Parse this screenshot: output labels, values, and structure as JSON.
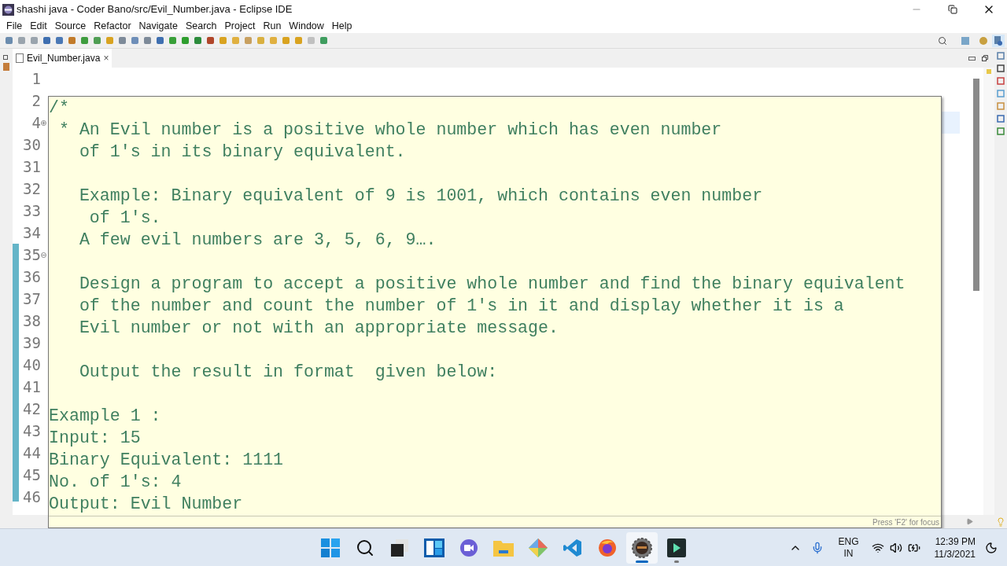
{
  "window": {
    "title": "shashi java - Coder Bano/src/Evil_Number.java - Eclipse IDE"
  },
  "menu": [
    "File",
    "Edit",
    "Source",
    "Refactor",
    "Navigate",
    "Search",
    "Project",
    "Run",
    "Window",
    "Help"
  ],
  "tabs": [
    {
      "label": "Evil_Number.java",
      "selected": true,
      "close": "×"
    }
  ],
  "editor": {
    "line_numbers": [
      "1",
      "2",
      "4",
      "30",
      "31",
      "32",
      "33",
      "34",
      "35",
      "36",
      "37",
      "38",
      "39",
      "40",
      "41",
      "42",
      "43",
      "44",
      "45",
      "46"
    ]
  },
  "hover": {
    "blocks": [
      [
        "/*",
        " * An Evil number is a positive whole number which has even number",
        "   of 1's in its binary equivalent."
      ],
      [
        "   Example: Binary equivalent of 9 is 1001, which contains even number",
        "    of 1's.",
        "   A few evil numbers are 3, 5, 6, 9…."
      ],
      [
        "   Design a program to accept a positive whole number and find the binary equivalent",
        "   of the number and count the number of 1's in it and display whether it is a",
        "   Evil number or not with an appropriate message."
      ],
      [
        "   Output the result in format  given below:"
      ],
      [
        "Example 1 :",
        "Input: 15",
        "Binary Equivalent: 1111",
        "No. of 1's: 4",
        "Output: Evil Number"
      ]
    ],
    "hint": "Press 'F2' for focus"
  },
  "taskbar": [
    {
      "kind": "start",
      "selected": false,
      "running": false
    },
    {
      "kind": "search",
      "selected": false,
      "running": false
    },
    {
      "kind": "taskview",
      "selected": false,
      "running": false
    },
    {
      "kind": "widgets",
      "selected": false,
      "running": false
    },
    {
      "kind": "chat",
      "selected": false,
      "running": false
    },
    {
      "kind": "files",
      "selected": false,
      "running": false
    },
    {
      "kind": "diamond",
      "selected": false,
      "running": false
    },
    {
      "kind": "code",
      "selected": false,
      "running": false
    },
    {
      "kind": "browser",
      "selected": false,
      "running": false
    },
    {
      "kind": "eclipse",
      "selected": true,
      "running": true
    },
    {
      "kind": "editor",
      "selected": false,
      "running": true
    }
  ],
  "tray": {
    "language": [
      "ENG",
      "IN"
    ],
    "time": "12:39 PM",
    "date": "11/3/2021"
  }
}
